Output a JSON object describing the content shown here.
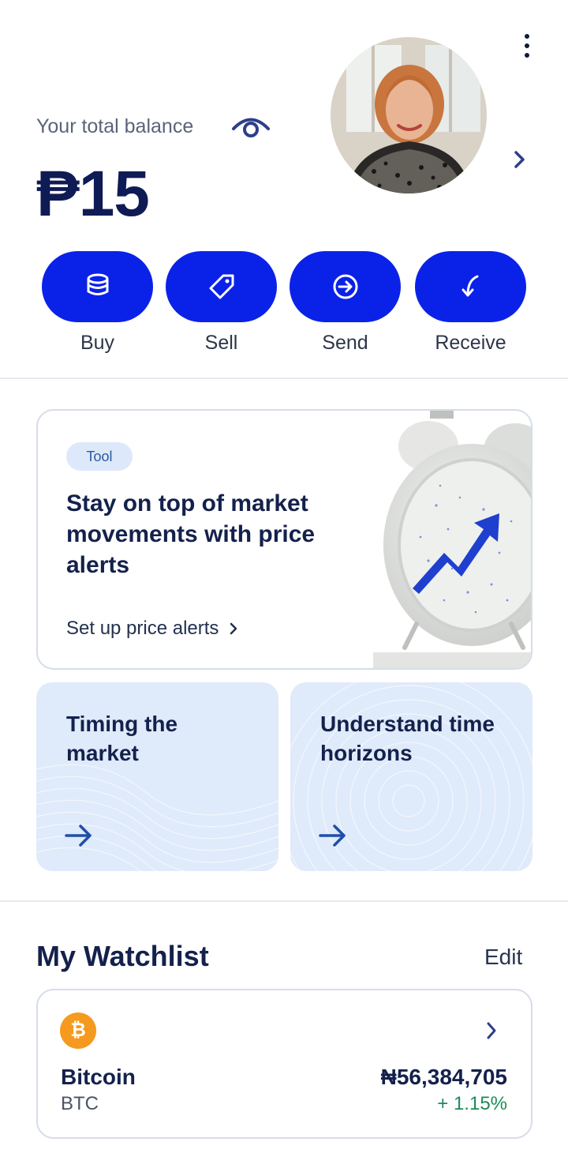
{
  "header": {
    "balance_label": "Your total balance",
    "balance_value": "₱15"
  },
  "actions": [
    {
      "label": "Buy",
      "icon": "coins-stack-icon"
    },
    {
      "label": "Sell",
      "icon": "tag-icon"
    },
    {
      "label": "Send",
      "icon": "arrow-circle-icon"
    },
    {
      "label": "Receive",
      "icon": "receive-arrow-icon"
    }
  ],
  "promo": {
    "badge": "Tool",
    "title": "Stay on top of market movements with price alerts",
    "link": "Set up price alerts"
  },
  "tiles": [
    {
      "title": "Timing the market"
    },
    {
      "title": "Understand time horizons"
    }
  ],
  "watchlist": {
    "title": "My Watchlist",
    "edit_label": "Edit",
    "items": [
      {
        "icon_glyph": "₿",
        "name": "Bitcoin",
        "ticker": "BTC",
        "price": "₦56,384,705",
        "change": "+ 1.15%"
      }
    ]
  },
  "colors": {
    "primary": "#0a22e8",
    "navy": "#0f1b54",
    "tile_bg": "#dfeafa",
    "positive": "#1e8a5a",
    "bitcoin": "#f59a1e"
  }
}
